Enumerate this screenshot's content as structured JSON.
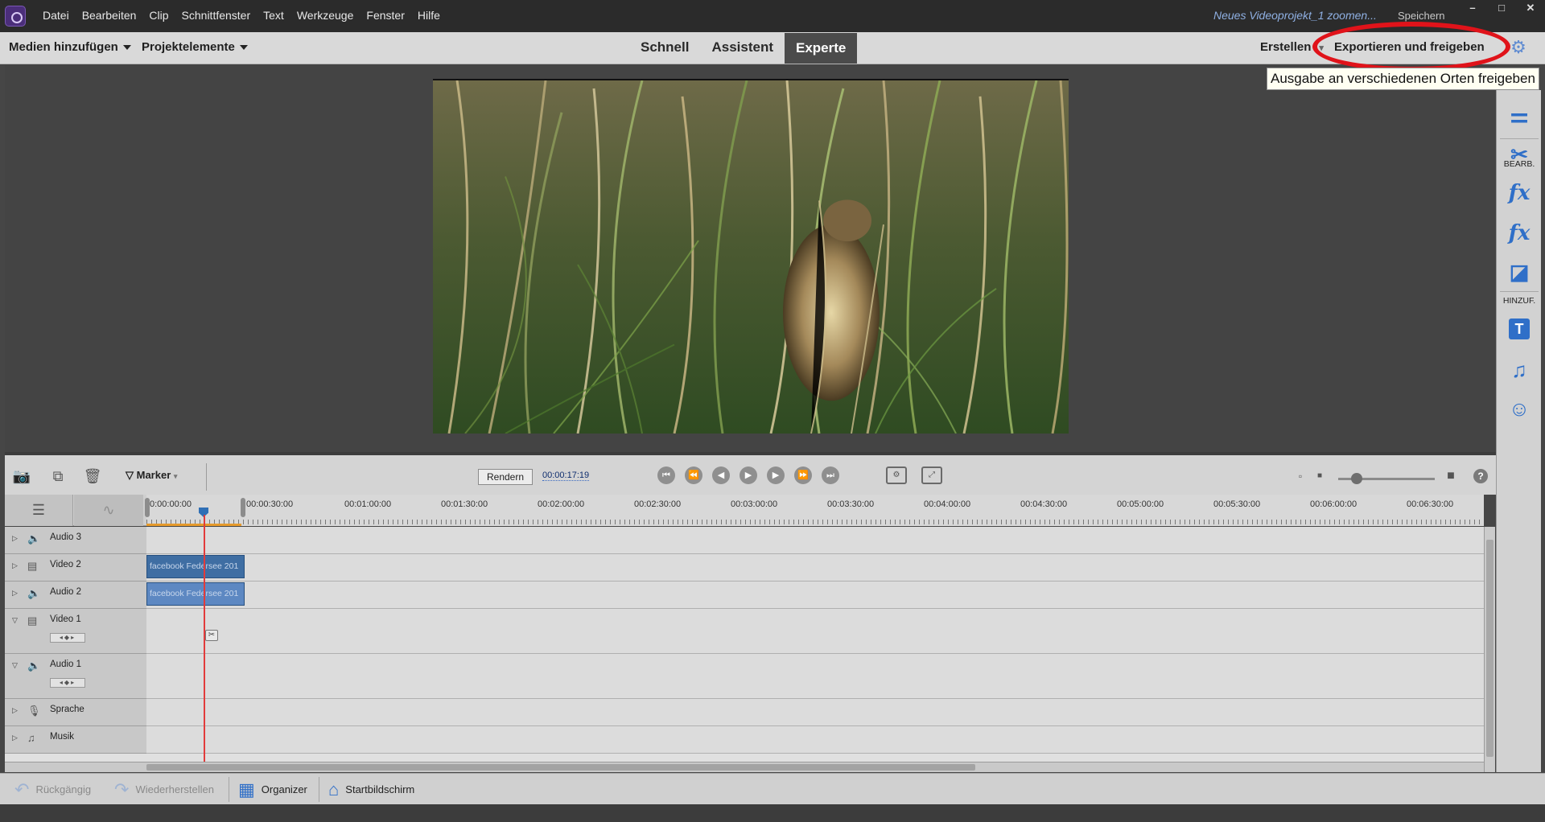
{
  "window": {
    "menu": [
      "Datei",
      "Bearbeiten",
      "Clip",
      "Schnittfenster",
      "Text",
      "Werkzeuge",
      "Fenster",
      "Hilfe"
    ],
    "doc_title": "Neues Videoprojekt_1 zoomen...",
    "save_label": "Speichern",
    "controls": [
      "–",
      "□",
      "✕"
    ]
  },
  "toolbar": {
    "add_media": "Medien hinzufügen",
    "project_assets": "Projektelemente",
    "modes": [
      "Schnell",
      "Assistent",
      "Experte"
    ],
    "active_mode": "Experte",
    "create": "Erstellen",
    "export_share": "Exportieren und freigeben",
    "tooltip": "Ausgabe an verschiedenen Orten freigeben"
  },
  "right_panel": {
    "edit_label": "BEARB.",
    "add_label": "HINZUF."
  },
  "timeline_controls": {
    "marker": "Marker",
    "render": "Rendern",
    "timecode": "00:00:17:19",
    "zoom_level": 0.15
  },
  "ruler": {
    "labels": [
      "0:00:00:00",
      "00:00:30:00",
      "00:01:00:00",
      "00:01:30:00",
      "00:02:00:00",
      "00:02:30:00",
      "00:03:00:00",
      "00:03:30:00",
      "00:04:00:00",
      "00:04:30:00",
      "00:05:00:00",
      "00:05:30:00",
      "00:06:00:00",
      "00:06:30:00"
    ]
  },
  "tracks": [
    {
      "name": "Audio 3",
      "type": "audio",
      "clip": ""
    },
    {
      "name": "Video 2",
      "type": "video",
      "clip": "facebook Federsee 201"
    },
    {
      "name": "Audio 2",
      "type": "audio",
      "clip": "facebook Federsee 201"
    },
    {
      "name": "Video 1",
      "type": "video",
      "clip": ""
    },
    {
      "name": "Audio 1",
      "type": "audio",
      "clip": ""
    },
    {
      "name": "Sprache",
      "type": "voice",
      "clip": ""
    },
    {
      "name": "Musik",
      "type": "music",
      "clip": ""
    }
  ],
  "bottom_bar": {
    "undo": "Rückgängig",
    "redo": "Wiederherstellen",
    "organizer": "Organizer",
    "home": "Startbildschirm"
  },
  "colors": {
    "accent_blue": "#2f6fc8",
    "clip_blue": "#3f6ea3",
    "highlight_red": "#e0131a",
    "playhead_red": "#e23b3b"
  }
}
